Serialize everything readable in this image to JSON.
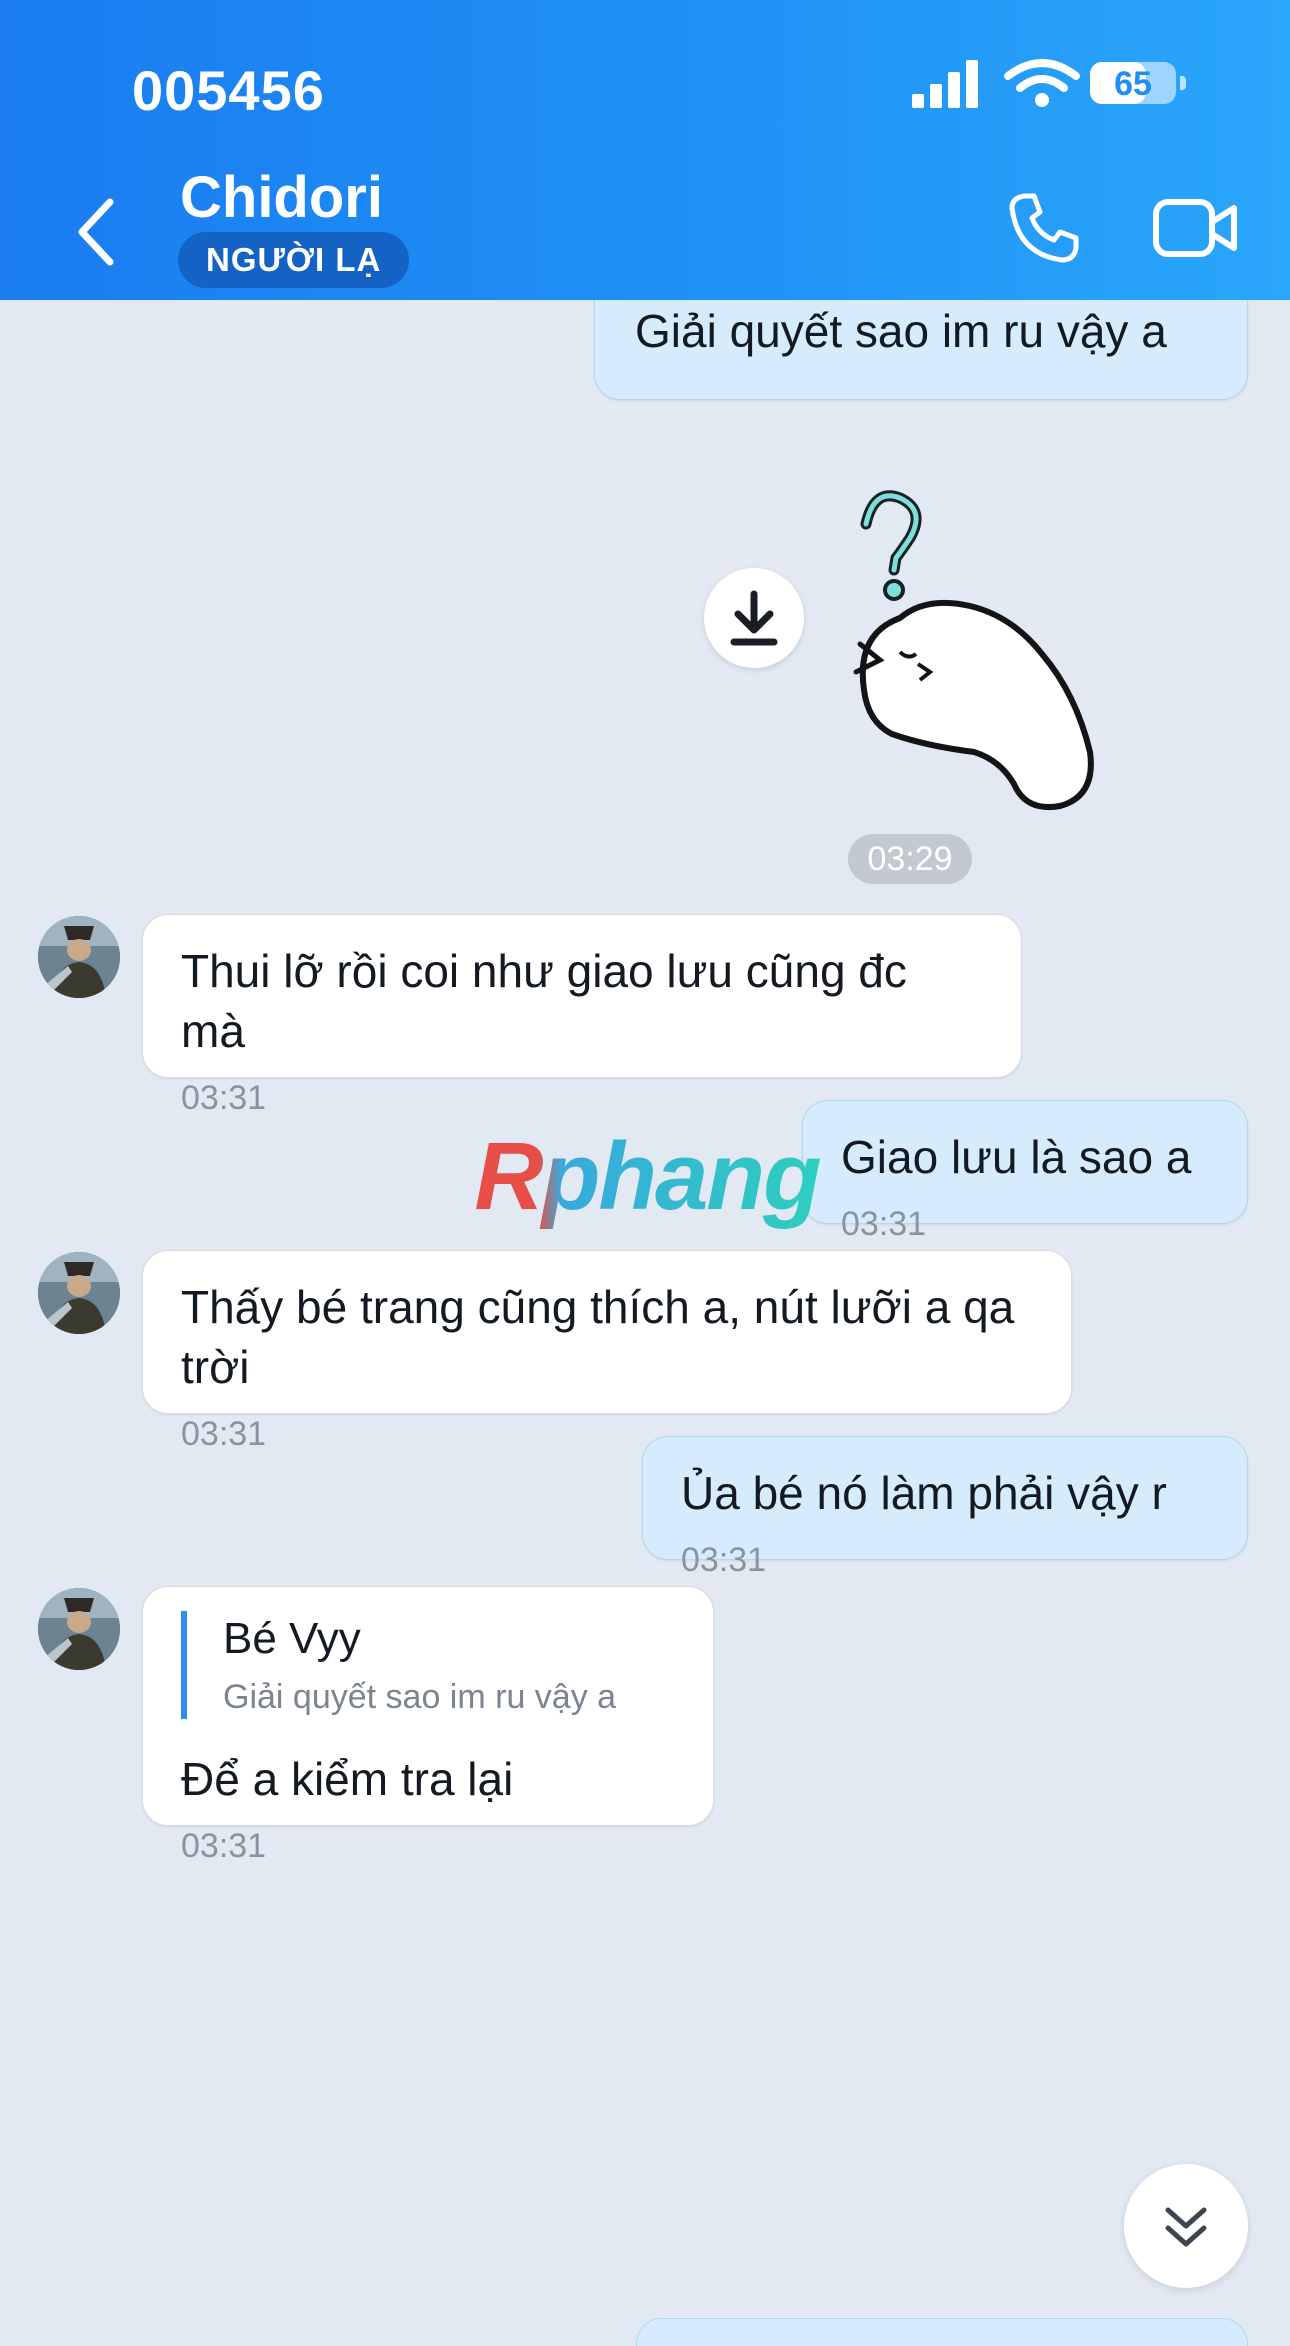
{
  "status_bar": {
    "time": "005456",
    "battery": "65",
    "battery_level": 0.65
  },
  "header": {
    "contact_name": "Chidori",
    "badge": "NGƯỜI LẠ"
  },
  "messages": [
    {
      "text": "Giải quyết sao im ru vậy a"
    },
    {
      "text": "Thui lỡ rồi coi như giao lưu cũng đc mà",
      "time": "03:31"
    },
    {
      "text": "Giao lưu là sao a",
      "time": "03:31"
    },
    {
      "text": "Thấy bé trang cũng thích a, nút lưỡi a qa trời",
      "time": "03:31"
    },
    {
      "text": "Ủa bé nó làm phải vậy r",
      "time": "03:31"
    },
    {
      "reply_to": {
        "name": "Bé Vyy",
        "text": "Giải quyết sao im ru vậy a"
      },
      "text": "Để a kiểm tra lại",
      "time": "03:31"
    }
  ],
  "sticker": {
    "time": "03:29"
  },
  "watermark": "Rphang",
  "colors": {
    "header_start": "#1a7cf0",
    "header_end": "#2aa6fb",
    "incoming_bubble": "#ffffff",
    "outgoing_bubble": "#d6ecfd",
    "chat_background": "#e2e9f2"
  }
}
